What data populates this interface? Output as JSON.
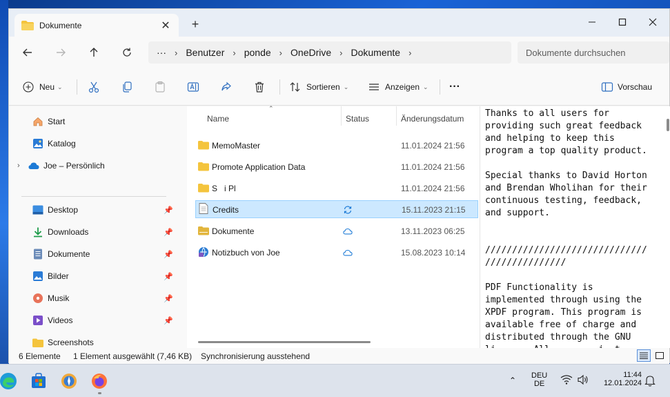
{
  "window": {
    "tab_title": "Dokumente",
    "tab_close": "✕",
    "new_tab": "+"
  },
  "address": {
    "more": "···",
    "crumbs": [
      "Benutzer",
      "ponde",
      "OneDrive",
      "Dokumente"
    ],
    "search_placeholder": "Dokumente durchsuchen"
  },
  "toolbar": {
    "new_label": "Neu",
    "sort_label": "Sortieren",
    "view_label": "Anzeigen",
    "more_label": "···",
    "preview_label": "Vorschau"
  },
  "sidebar": {
    "top": [
      {
        "label": "Start",
        "icon": "home-icon"
      },
      {
        "label": "Katalog",
        "icon": "gallery-icon"
      },
      {
        "label": "Joe – Persönlich",
        "icon": "cloud-icon"
      }
    ],
    "pinned": [
      {
        "label": "Desktop",
        "icon": "desktop-icon"
      },
      {
        "label": "Downloads",
        "icon": "download-icon"
      },
      {
        "label": "Dokumente",
        "icon": "document-icon"
      },
      {
        "label": "Bilder",
        "icon": "pictures-icon"
      },
      {
        "label": "Musik",
        "icon": "music-icon"
      },
      {
        "label": "Videos",
        "icon": "video-icon"
      },
      {
        "label": "Screenshots",
        "icon": "folder-icon"
      }
    ]
  },
  "filelist": {
    "columns": {
      "name": "Name",
      "status": "Status",
      "date": "Änderungsdatum"
    },
    "rows": [
      {
        "name": "MemoMaster",
        "status": "",
        "date": "11.01.2024 21:56",
        "icon": "folder-icon"
      },
      {
        "name": "Promote Application Data",
        "status": "",
        "date": "11.01.2024 21:56",
        "icon": "folder-icon"
      },
      {
        "name": "S   i Pl",
        "status": "",
        "date": "11.01.2024 21:56",
        "icon": "folder-icon"
      },
      {
        "name": "Credits",
        "status": "sync",
        "date": "15.11.2023 21:15",
        "icon": "text-file-icon"
      },
      {
        "name": "Dokumente",
        "status": "cloud",
        "date": "13.11.2023 06:25",
        "icon": "folder-icon"
      },
      {
        "name": "Notizbuch von Joe",
        "status": "cloud",
        "date": "15.08.2023 10:14",
        "icon": "notebook-icon"
      }
    ]
  },
  "preview": {
    "text": "Thanks to all users for\nproviding such great feedback\nand helping to keep this\nprogram a top quality product.\n\nSpecial thanks to David Horton\nand Brendan Wholihan for their\ncontinuous testing, feedback,\nand support.\n\n\n//////////////////////////////\n///////////////\n\nPDF Functionality is\nimplemented through using the\nXPDF program. This program is\navailable free of charge and\ndistributed through the GNU\nli       All         i  t"
  },
  "status": {
    "count": "6 Elemente",
    "selection": "1 Element ausgewählt (7,46 KB)",
    "sync": "Synchronisierung ausstehend"
  },
  "tray": {
    "lang1": "DEU",
    "lang2": "DE",
    "time": "11:44",
    "date": "12.01.2024"
  },
  "colors": {
    "folder": "#f4c43d",
    "accent": "#0078d4",
    "selection": "#cce8ff"
  }
}
